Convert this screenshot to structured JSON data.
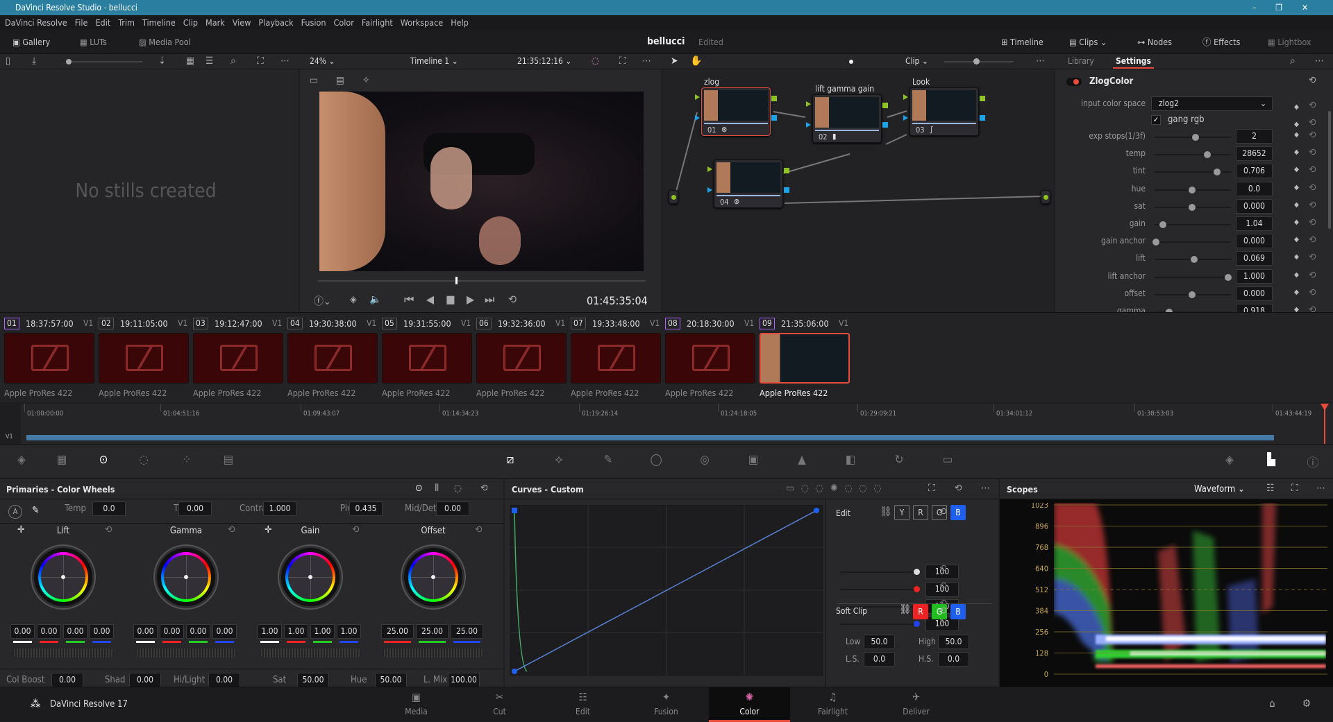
{
  "window": {
    "title": "DaVinci Resolve Studio - bellucci"
  },
  "menu": [
    "DaVinci Resolve",
    "File",
    "Edit",
    "Trim",
    "Timeline",
    "Clip",
    "Mark",
    "View",
    "Playback",
    "Fusion",
    "Color",
    "Fairlight",
    "Workspace",
    "Help"
  ],
  "topbar": {
    "gallery": "Gallery",
    "luts": "LUTs",
    "media_pool": "Media Pool",
    "project": "bellucci",
    "status": "Edited",
    "timeline": "Timeline",
    "clips": "Clips",
    "nodes": "Nodes",
    "effects": "Effects",
    "lightbox": "Lightbox"
  },
  "viewer": {
    "zoom": "24%",
    "timeline_name": "Timeline 1",
    "timecode_top": "21:35:12:16",
    "timecode": "01:45:35:04",
    "playhead_fraction": 0.42
  },
  "gallery": {
    "empty_text": "No stills created"
  },
  "node_editor": {
    "mode": "Clip",
    "nodes": [
      {
        "label": "zlog",
        "num": "01"
      },
      {
        "label": "lift gamma gain",
        "num": "02"
      },
      {
        "label": "Look",
        "num": "03"
      },
      {
        "label": "",
        "num": "04"
      }
    ]
  },
  "settings": {
    "tabs": [
      "Library",
      "Settings"
    ],
    "active_tab": "Settings",
    "effect_name": "ZlogColor",
    "input_color_space_label": "input color space",
    "input_color_space": "zlog2",
    "gang_rgb_label": "gang rgb",
    "gang_rgb": true,
    "params": [
      {
        "label": "exp stops(1/3f)",
        "value": "2",
        "slider": 0.55
      },
      {
        "label": "temp",
        "value": "28652",
        "slider": 0.71
      },
      {
        "label": "tint",
        "value": "0.706",
        "slider": 0.85
      },
      {
        "label": "hue",
        "value": "0.0",
        "slider": 0.5
      },
      {
        "label": "sat",
        "value": "0.000",
        "slider": 0.5
      },
      {
        "label": "gain",
        "value": "1.04",
        "slider": 0.1
      },
      {
        "label": "gain anchor",
        "value": "0.000",
        "slider": 0.0
      },
      {
        "label": "lift",
        "value": "0.069",
        "slider": 0.53
      },
      {
        "label": "lift anchor",
        "value": "1.000",
        "slider": 1.0
      },
      {
        "label": "offset",
        "value": "0.000",
        "slider": 0.5
      },
      {
        "label": "gamma",
        "value": "0.918",
        "slider": 0.18
      }
    ]
  },
  "clips": [
    {
      "num": "01",
      "tc": "18:37:57:00",
      "track": "V1",
      "codec": "Apple ProRes 422",
      "offline": true
    },
    {
      "num": "02",
      "tc": "19:11:05:00",
      "track": "V1",
      "codec": "Apple ProRes 422",
      "offline": true
    },
    {
      "num": "03",
      "tc": "19:12:47:00",
      "track": "V1",
      "codec": "Apple ProRes 422",
      "offline": true
    },
    {
      "num": "04",
      "tc": "19:30:38:00",
      "track": "V1",
      "codec": "Apple ProRes 422",
      "offline": true
    },
    {
      "num": "05",
      "tc": "19:31:55:00",
      "track": "V1",
      "codec": "Apple ProRes 422",
      "offline": true
    },
    {
      "num": "06",
      "tc": "19:32:36:00",
      "track": "V1",
      "codec": "Apple ProRes 422",
      "offline": true
    },
    {
      "num": "07",
      "tc": "19:33:48:00",
      "track": "V1",
      "codec": "Apple ProRes 422",
      "offline": true
    },
    {
      "num": "08",
      "tc": "20:18:30:00",
      "track": "V1",
      "codec": "Apple ProRes 422",
      "offline": true
    },
    {
      "num": "09",
      "tc": "21:35:06:00",
      "track": "V1",
      "codec": "Apple ProRes 422",
      "offline": false,
      "selected": true
    }
  ],
  "timeline": {
    "track": "V1",
    "ruler": [
      "01:00:00:00",
      "01:04:51:16",
      "01:09:43:07",
      "01:14:34:23",
      "01:19:26:14",
      "01:24:18:05",
      "01:29:09:21",
      "01:34:01:12",
      "01:38:53:03",
      "01:43:44:19"
    ]
  },
  "primaries": {
    "title": "Primaries - Color Wheels",
    "temp_label": "Temp",
    "temp": "0.0",
    "tint_label": "Tint",
    "tint": "0.00",
    "contrast_label": "Contrast",
    "contrast": "1.000",
    "pivot_label": "Pivot",
    "pivot": "0.435",
    "mid_label": "Mid/Detail",
    "mid": "0.00",
    "wheels": [
      {
        "name": "Lift",
        "values": [
          "0.00",
          "0.00",
          "0.00",
          "0.00"
        ]
      },
      {
        "name": "Gamma",
        "values": [
          "0.00",
          "0.00",
          "0.00",
          "0.00"
        ]
      },
      {
        "name": "Gain",
        "values": [
          "1.00",
          "1.00",
          "1.00",
          "1.00"
        ]
      },
      {
        "name": "Offset",
        "values": [
          "25.00",
          "25.00",
          "25.00"
        ]
      }
    ],
    "bottom": [
      {
        "label": "Col Boost",
        "value": "0.00"
      },
      {
        "label": "Shad",
        "value": "0.00"
      },
      {
        "label": "Hi/Light",
        "value": "0.00"
      },
      {
        "label": "Sat",
        "value": "50.00"
      },
      {
        "label": "Hue",
        "value": "50.00"
      },
      {
        "label": "L. Mix",
        "value": "100.00"
      }
    ]
  },
  "curves": {
    "title": "Curves - Custom",
    "edit_label": "Edit",
    "channels": [
      "Y",
      "R",
      "G",
      "B"
    ],
    "intensities": [
      "100",
      "100",
      "100",
      "100"
    ],
    "softclip_label": "Soft Clip",
    "softclip_channels": [
      "R",
      "G",
      "B"
    ],
    "low_label": "Low",
    "low": "50.0",
    "high_label": "High",
    "high": "50.0",
    "ls_label": "L.S.",
    "ls": "0.0",
    "hs_label": "H.S.",
    "hs": "0.0"
  },
  "scopes": {
    "title": "Scopes",
    "mode": "Waveform",
    "scale": [
      "1023",
      "896",
      "768",
      "640",
      "512",
      "384",
      "256",
      "128",
      "0"
    ]
  },
  "pages": {
    "app": "DaVinci Resolve 17",
    "items": [
      "Media",
      "Cut",
      "Edit",
      "Fusion",
      "Color",
      "Fairlight",
      "Deliver"
    ],
    "active": "Color"
  },
  "colors": {
    "accent": "#e64b3c",
    "titlebar": "#2a7fa0",
    "track": "#4479a6",
    "node_green": "#8fc31f",
    "node_blue": "#1aa3e8"
  }
}
